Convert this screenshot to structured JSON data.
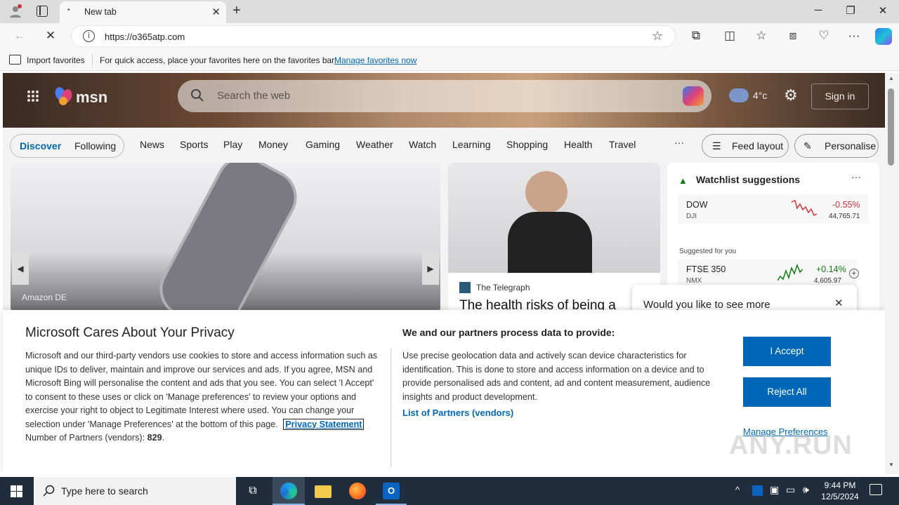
{
  "browser": {
    "tab_title": "New tab",
    "url": "https://o365atp.com",
    "favbar": {
      "import_label": "Import favorites",
      "hint": "For quick access, place your favorites here on the favorites bar.",
      "manage_link": "Manage favorites now"
    }
  },
  "msn": {
    "logo": "msn",
    "search_placeholder": "Search the web",
    "temperature": "4°c",
    "signin": "Sign in",
    "discover": "Discover",
    "following": "Following",
    "nav_items": [
      "News",
      "Sports",
      "Play",
      "Money",
      "Gaming",
      "Weather",
      "Watch",
      "Learning",
      "Shopping",
      "Health",
      "Travel"
    ],
    "more": "···",
    "feed_layout": "Feed layout",
    "personalise": "Personalise",
    "card1_source": "Amazon DE",
    "card2_source": "The Telegraph",
    "card2_headline": "The health risks of being a",
    "watchlist": {
      "title": "Watchlist suggestions",
      "item1": {
        "symbol": "DOW",
        "sub": "DJI",
        "change": "-0.55%",
        "value": "44,765.71"
      },
      "suggested_label": "Suggested for you",
      "item2": {
        "symbol": "FTSE 350",
        "sub": "NMX",
        "change": "+0.14%",
        "value": "4,605.97"
      }
    },
    "popup_text": "Would you like to see more"
  },
  "privacy": {
    "title": "Microsoft Cares About Your Privacy",
    "left_text": "Microsoft and our third-party vendors use cookies to store and access information such as unique IDs to deliver, maintain and improve our services and ads. If you agree, MSN and Microsoft Bing will personalise the content and ads that you see. You can select 'I Accept' to consent to these uses or click on 'Manage preferences' to review your options and exercise your right to object to Legitimate Interest where used.  You can change your selection under 'Manage Preferences' at the bottom of this page.",
    "privacy_link": "Privacy Statement",
    "partners_label": "Number of Partners (vendors):",
    "partners_count": "829",
    "right_title": "We and our partners process data to provide:",
    "right_text": "Use precise geolocation data and actively scan device characteristics for identification. This is done to store and access information on a device and to provide personalised ads and content, ad and content measurement, audience insights and product development.",
    "list_partners": "List of Partners (vendors)",
    "accept": "I Accept",
    "reject": "Reject All",
    "manage": "Manage Preferences"
  },
  "taskbar": {
    "search_placeholder": "Type here to search",
    "time": "9:44 PM",
    "date": "12/5/2024"
  },
  "watermark": "ANY.RUN",
  "colors": {
    "accent": "#0067b8",
    "taskbar": "#1f2d3d",
    "stock_down": "#d13438",
    "stock_up": "#107c10"
  }
}
